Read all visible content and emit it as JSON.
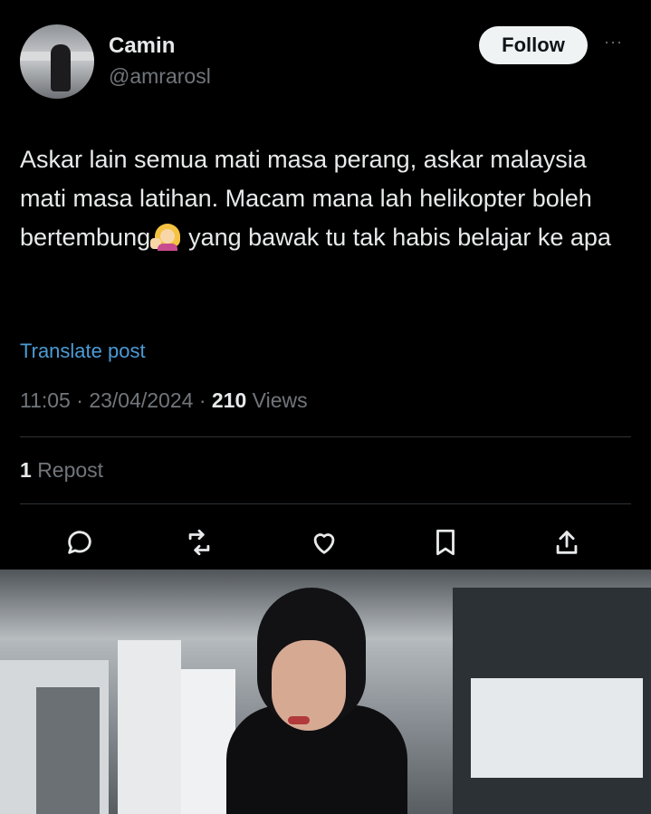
{
  "author": {
    "display_name": "Camin",
    "handle": "@amrarosl",
    "follow_label": "Follow",
    "more_label": "···"
  },
  "post": {
    "text_part1": "Askar lain semua mati masa perang, askar malaysia mati masa latihan. Macam mana lah helikopter boleh bertembung",
    "emoji": "woman-facepalming-emoji",
    "text_part2": "yang bawak tu tak habis belajar ke apa",
    "translate_label": "Translate post",
    "time": "11:05",
    "date": "23/04/2024",
    "views_count": "210",
    "views_label": "Views",
    "repost_count": "1",
    "repost_label": "Repost"
  },
  "actions": [
    {
      "icon": "reply-icon"
    },
    {
      "icon": "retweet-icon"
    },
    {
      "icon": "like-icon"
    },
    {
      "icon": "bookmark-icon"
    },
    {
      "icon": "share-icon"
    }
  ],
  "colors": {
    "background": "#000000",
    "text": "#e7e9ea",
    "secondary_text": "#71767b",
    "link": "#4c9bd6",
    "follow_button_bg": "#eff3f4"
  }
}
